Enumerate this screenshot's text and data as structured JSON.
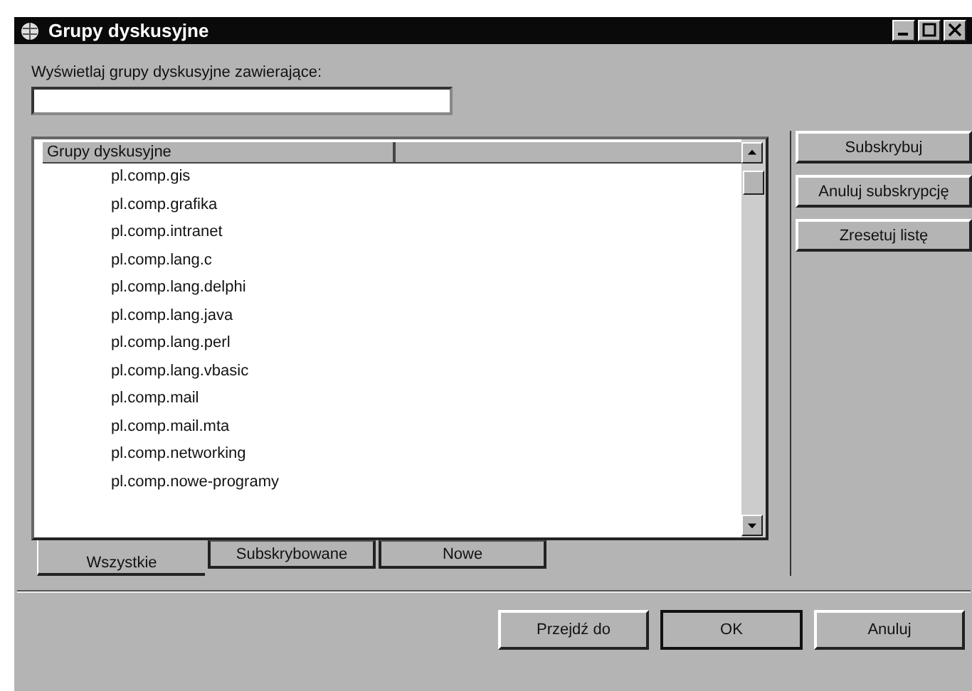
{
  "window": {
    "title": "Grupy dyskusyjne"
  },
  "filter": {
    "label": "Wyświetlaj grupy dyskusyjne zawierające:"
  },
  "list": {
    "columns": [
      "Grupy dyskusyjne"
    ],
    "rows": [
      "pl.comp.gis",
      "pl.comp.grafika",
      "pl.comp.intranet",
      "pl.comp.lang.c",
      "pl.comp.lang.delphi",
      "pl.comp.lang.java",
      "pl.comp.lang.perl",
      "pl.comp.lang.vbasic",
      "pl.comp.mail",
      "pl.comp.mail.mta",
      "pl.comp.networking",
      "pl.comp.nowe-programy"
    ]
  },
  "side_buttons": [
    "Subskrybuj",
    "Anuluj subskrypcję",
    "Zresetuj listę"
  ],
  "tabs": [
    {
      "label": "Wszystkie",
      "selected": true
    },
    {
      "label": "Subskrybowane",
      "selected": false
    },
    {
      "label": "Nowe",
      "selected": false
    }
  ],
  "buttons": [
    {
      "label": "Przejdź do",
      "default": false
    },
    {
      "label": "OK",
      "default": true
    },
    {
      "label": "Anuluj",
      "default": false
    }
  ]
}
